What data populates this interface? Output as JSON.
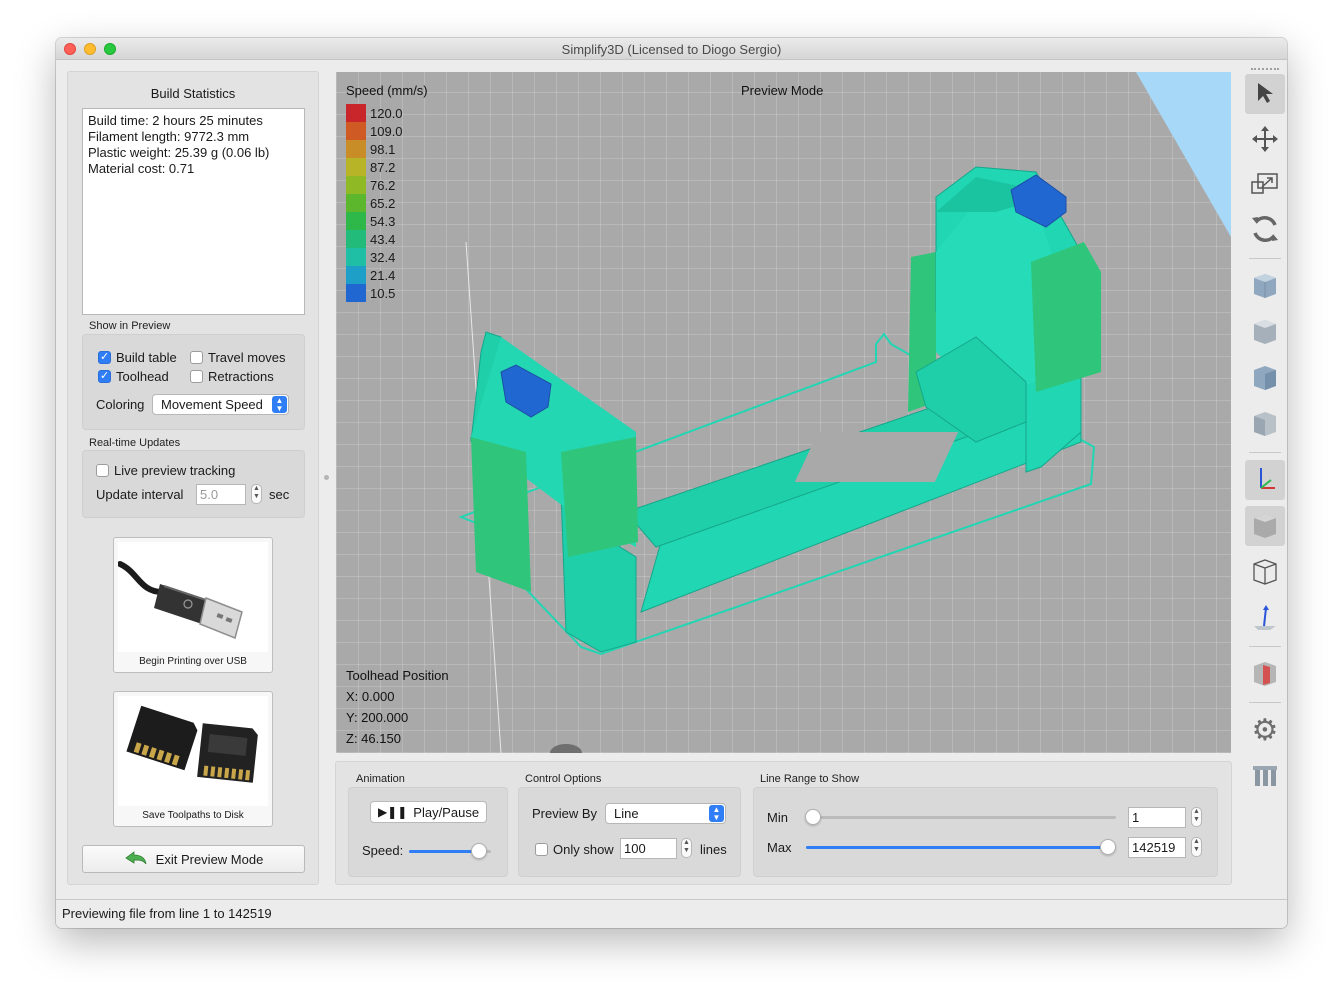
{
  "window": {
    "title": "Simplify3D (Licensed to Diogo Sergio)"
  },
  "build_statistics": {
    "heading": "Build Statistics",
    "lines": [
      "Build time: 2 hours 25 minutes",
      "Filament length: 9772.3 mm",
      "Plastic weight: 25.39 g (0.06 lb)",
      "Material cost: 0.71"
    ]
  },
  "show_in_preview": {
    "label": "Show in Preview",
    "build_table": {
      "label": "Build table",
      "checked": true
    },
    "travel_moves": {
      "label": "Travel moves",
      "checked": false
    },
    "toolhead": {
      "label": "Toolhead",
      "checked": true
    },
    "retractions": {
      "label": "Retractions",
      "checked": false
    },
    "coloring_label": "Coloring",
    "coloring_value": "Movement Speed"
  },
  "realtime": {
    "label": "Real-time Updates",
    "live_preview": {
      "label": "Live preview tracking",
      "checked": false
    },
    "interval_label": "Update interval",
    "interval_value": "5.0",
    "interval_unit": "sec"
  },
  "actions": {
    "usb_caption": "Begin Printing over USB",
    "sd_caption": "Save Toolpaths to Disk",
    "exit_label": "Exit Preview Mode"
  },
  "viewport": {
    "legend_title": "Speed (mm/s)",
    "mode_label": "Preview Mode",
    "legend": [
      {
        "value": "120.0",
        "color": "#c8262a"
      },
      {
        "value": "109.0",
        "color": "#cf5a24"
      },
      {
        "value": "98.1",
        "color": "#c88d27"
      },
      {
        "value": "87.2",
        "color": "#b7b427"
      },
      {
        "value": "76.2",
        "color": "#8fba26"
      },
      {
        "value": "65.2",
        "color": "#5cb72c"
      },
      {
        "value": "54.3",
        "color": "#2fb84a"
      },
      {
        "value": "43.4",
        "color": "#22bb7a"
      },
      {
        "value": "32.4",
        "color": "#1fbfa6"
      },
      {
        "value": "21.4",
        "color": "#1e9fc8"
      },
      {
        "value": "10.5",
        "color": "#2167d1"
      }
    ],
    "toolhead_title": "Toolhead Position",
    "x": "X: 0.000",
    "y": "Y: 200.000",
    "z": "Z: 46.150"
  },
  "animation": {
    "label": "Animation",
    "play_label": "Play/Pause",
    "speed_label": "Speed:",
    "speed_level": 0.85
  },
  "control_options": {
    "label": "Control Options",
    "preview_by_label": "Preview By",
    "preview_by_value": "Line",
    "only_show_label": "Only show",
    "only_show_checked": false,
    "only_show_value": "100",
    "lines_label": "lines"
  },
  "line_range": {
    "label": "Line Range to Show",
    "min_label": "Min",
    "min_value": "1",
    "max_label": "Max",
    "max_value": "142519"
  },
  "status": {
    "text": "Previewing file from line 1 to 142519"
  },
  "colors": {
    "accent": "#2f7ef6",
    "model": "#21d6b3",
    "model_dark": "#14a78b",
    "support": "#2fc57a",
    "bed": "#a9a9a9",
    "sky": "#a7d8f7"
  }
}
